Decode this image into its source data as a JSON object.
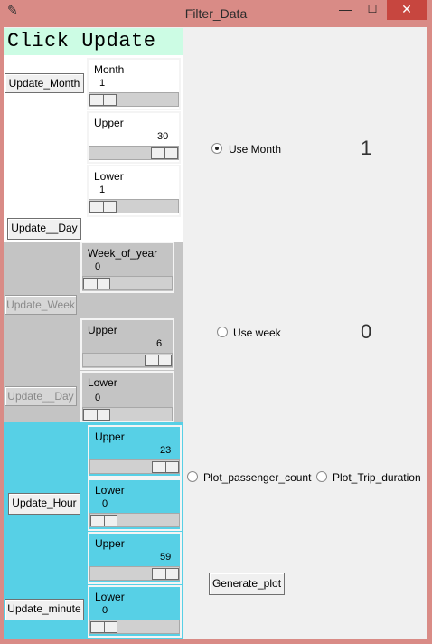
{
  "window": {
    "title": "Filter_Data",
    "icon": "feather-icon",
    "min": "—",
    "max": "☐",
    "close": "✕"
  },
  "header": {
    "click_update": "Click Update"
  },
  "month_section": {
    "update_month": "Update_Month",
    "update_day": "Update__Day",
    "month": {
      "label": "Month",
      "value": "1",
      "fraction": 0.0
    },
    "upper": {
      "label": "Upper",
      "value": "30",
      "fraction": 1.0
    },
    "lower": {
      "label": "Lower",
      "value": "1",
      "fraction": 0.0
    }
  },
  "week_section": {
    "update_week": "Update_Week",
    "update_day": "Update__Day",
    "week_of_year": {
      "label": "Week_of_year",
      "value": "0",
      "fraction": 0.0
    },
    "upper": {
      "label": "Upper",
      "value": "6",
      "fraction": 1.0
    },
    "lower": {
      "label": "Lower",
      "value": "0",
      "fraction": 0.0
    }
  },
  "time_section": {
    "update_hour": "Update_Hour",
    "update_minute": "Update_minute",
    "hour_upper": {
      "label": "Upper",
      "value": "23",
      "fraction": 1.0
    },
    "hour_lower": {
      "label": "Lower",
      "value": "0",
      "fraction": 0.0
    },
    "minute_upper": {
      "label": "Upper",
      "value": "59",
      "fraction": 1.0
    },
    "minute_lower": {
      "label": "Lower",
      "value": "0",
      "fraction": 0.0
    }
  },
  "right": {
    "use_month": {
      "label": "Use Month",
      "selected": true,
      "display": "1"
    },
    "use_week": {
      "label": "Use week",
      "selected": false,
      "display": "0"
    },
    "plot_passenger": {
      "label": "Plot_passenger_count",
      "selected": false
    },
    "plot_trip": {
      "label": "Plot_Trip_duration",
      "selected": false
    },
    "generate": "Generate_plot"
  },
  "colors": {
    "titlebar": "#d98b86",
    "close": "#c7463f",
    "header_bg": "#ccfce4",
    "gray_panel": "#c4c4c4",
    "cyan_panel": "#57d0e6"
  }
}
